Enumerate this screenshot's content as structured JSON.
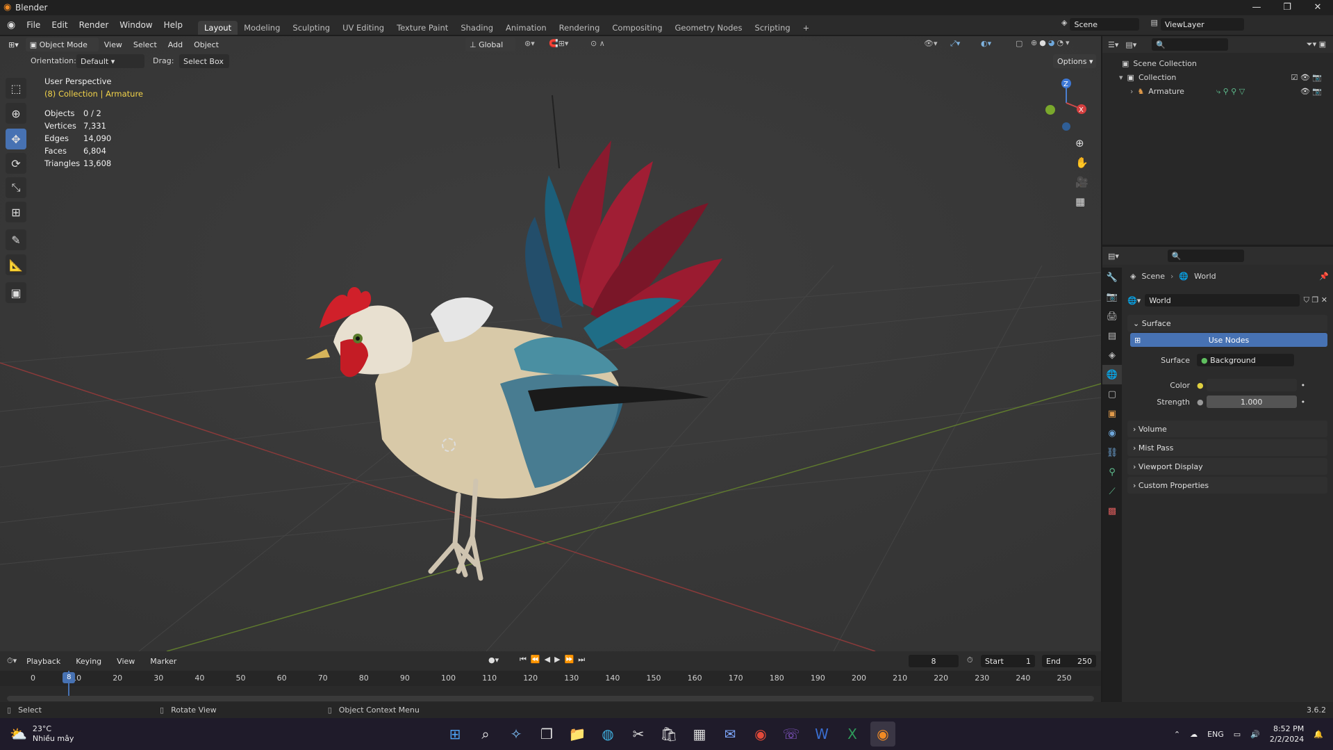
{
  "app": {
    "title": "Blender",
    "version": "3.6.2"
  },
  "window_controls": {
    "minimize": "—",
    "maximize": "❐",
    "close": "✕"
  },
  "menubar": {
    "menus": [
      "File",
      "Edit",
      "Render",
      "Window",
      "Help"
    ],
    "workspaces": [
      "Layout",
      "Modeling",
      "Sculpting",
      "UV Editing",
      "Texture Paint",
      "Shading",
      "Animation",
      "Rendering",
      "Compositing",
      "Geometry Nodes",
      "Scripting"
    ],
    "add_workspace": "+",
    "scene": "Scene",
    "view_layer": "ViewLayer"
  },
  "viewport": {
    "mode": "Object Mode",
    "menus": [
      "View",
      "Select",
      "Add",
      "Object"
    ],
    "transform_orientation": "Global",
    "orientation_label": "Orientation:",
    "orientation_value": "Default",
    "drag_label": "Drag:",
    "drag_value": "Select Box",
    "options": "Options",
    "perspective": "User Perspective",
    "collection_info": "(8) Collection | Armature",
    "stats": [
      {
        "label": "Objects",
        "value": "0 / 2"
      },
      {
        "label": "Vertices",
        "value": "7,331"
      },
      {
        "label": "Edges",
        "value": "14,090"
      },
      {
        "label": "Faces",
        "value": "6,804"
      },
      {
        "label": "Triangles",
        "value": "13,608"
      }
    ],
    "gizmo_z": "Z",
    "gizmo_x": "X"
  },
  "outliner": {
    "scene_collection": "Scene Collection",
    "collection": "Collection",
    "armature": "Armature"
  },
  "properties": {
    "breadcrumb_scene": "Scene",
    "breadcrumb_world": "World",
    "world_name": "World",
    "surface_panel": "Surface",
    "use_nodes": "Use Nodes",
    "surface_label": "Surface",
    "surface_value": "Background",
    "color_label": "Color",
    "strength_label": "Strength",
    "strength_value": "1.000",
    "panels": [
      "Volume",
      "Mist Pass",
      "Viewport Display",
      "Custom Properties"
    ]
  },
  "timeline": {
    "menus": [
      "Playback",
      "Keying",
      "View",
      "Marker"
    ],
    "current_frame": "8",
    "start_label": "Start",
    "start_value": "1",
    "end_label": "End",
    "end_value": "250",
    "ticks": [
      "0",
      "10",
      "20",
      "30",
      "40",
      "50",
      "60",
      "70",
      "80",
      "90",
      "100",
      "110",
      "120",
      "130",
      "140",
      "150",
      "160",
      "170",
      "180",
      "190",
      "200",
      "210",
      "220",
      "230",
      "240",
      "250"
    ],
    "playhead": "8"
  },
  "statusbar": {
    "select": "Select",
    "rotate": "Rotate View",
    "context": "Object Context Menu",
    "version": "3.6.2"
  },
  "taskbar": {
    "weather_temp": "23°C",
    "weather_desc": "Nhiều mây",
    "lang": "ENG",
    "time": "8:52 PM",
    "date": "2/2/2024"
  }
}
